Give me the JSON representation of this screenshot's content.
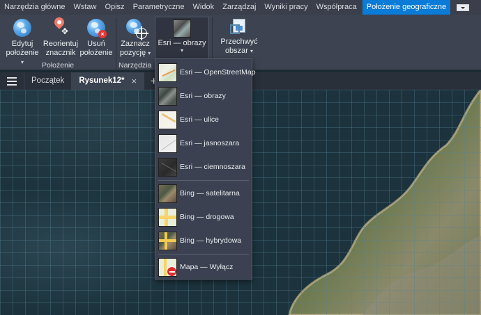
{
  "tabs": [
    {
      "label": "Narzędzia główne"
    },
    {
      "label": "Wstaw"
    },
    {
      "label": "Opisz"
    },
    {
      "label": "Parametryczne"
    },
    {
      "label": "Widok"
    },
    {
      "label": "Zarządzaj"
    },
    {
      "label": "Wyniki pracy"
    },
    {
      "label": "Współpraca"
    },
    {
      "label": "Położenie geograficzne",
      "active": true
    }
  ],
  "ribbon": {
    "edit": {
      "line1": "Edytuj",
      "line2": "położenie"
    },
    "reorient": {
      "line1": "Reorientuj",
      "line2": "znacznik"
    },
    "remove": {
      "line1": "Usuń",
      "line2": "położenie"
    },
    "mark": {
      "line1": "Zaznacz",
      "line2": "pozycję"
    },
    "map_selected": "Esri — obrazy",
    "capture": {
      "line1": "Przechwyć",
      "line2": "obszar"
    },
    "panel_location": "Położenie",
    "panel_tools": "Narzędzia"
  },
  "doctabs": {
    "start": "Początek",
    "drawing": "Rysunek12*",
    "close": "×",
    "add": "+"
  },
  "menu": {
    "items": [
      {
        "label": "Esri — OpenStreetMap",
        "icon": "osm-thumb-icon"
      },
      {
        "label": "Esri — obrazy",
        "icon": "imagery-thumb-icon"
      },
      {
        "label": "Esri — ulice",
        "icon": "streets-thumb-icon"
      },
      {
        "label": "Esri — jasnoszara",
        "icon": "light-gray-thumb-icon"
      },
      {
        "label": "Esri — ciemnoszara",
        "icon": "dark-gray-thumb-icon"
      },
      {
        "label": "Bing — satelitarna",
        "icon": "satellite-thumb-icon"
      },
      {
        "label": "Bing — drogowa",
        "icon": "road-thumb-icon"
      },
      {
        "label": "Bing — hybrydowa",
        "icon": "hybrid-thumb-icon"
      },
      {
        "label": "Mapa — Wyłącz",
        "icon": "map-off-icon"
      }
    ]
  },
  "colors": {
    "accent": "#0a7bd6",
    "ribbon_bg": "#3d4350",
    "menu_bg": "#3b4150"
  }
}
